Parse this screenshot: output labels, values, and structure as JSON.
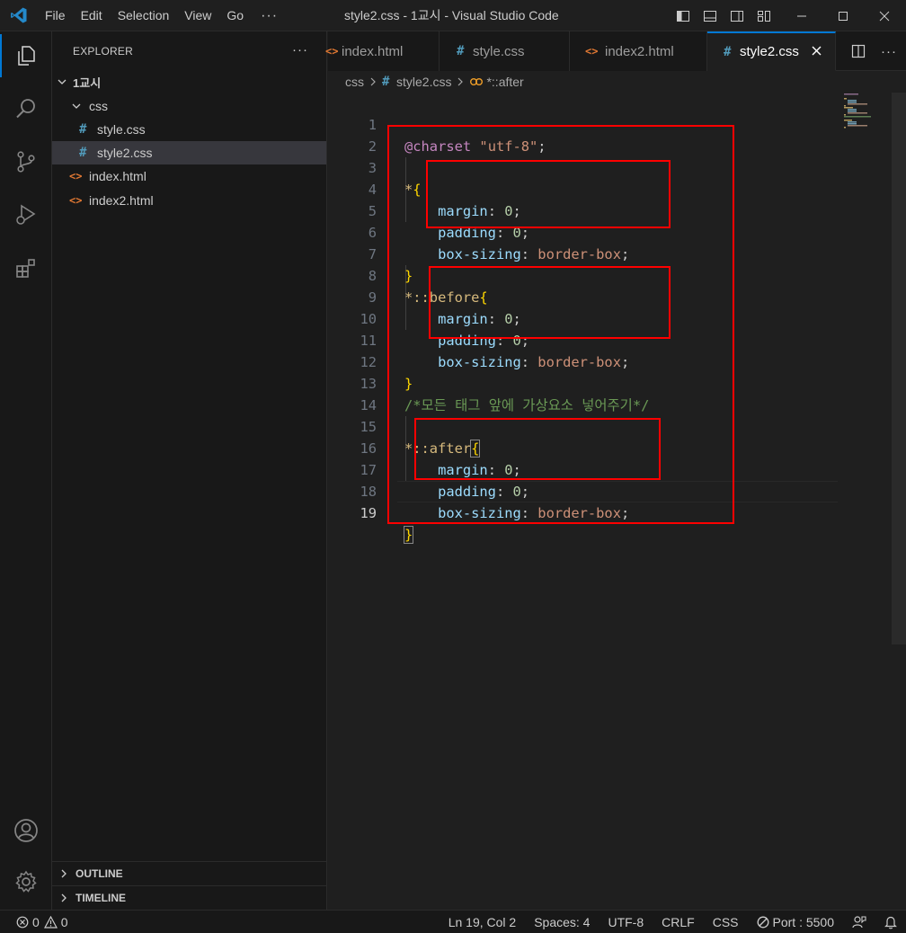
{
  "window": {
    "title": "style2.css - 1교시 - Visual Studio Code",
    "menu": [
      "File",
      "Edit",
      "Selection",
      "View",
      "Go"
    ],
    "menu_more": "···"
  },
  "sidebar": {
    "header": "EXPLORER",
    "header_more": "···",
    "root_folder": "1교시",
    "folder_css": "css",
    "files": [
      "style.css",
      "style2.css",
      "index.html",
      "index2.html"
    ],
    "outline": "OUTLINE",
    "timeline": "TIMELINE"
  },
  "tabs": [
    {
      "label": "index.html",
      "icon": "html-icon"
    },
    {
      "label": "style.css",
      "icon": "css-hash-icon"
    },
    {
      "label": "index2.html",
      "icon": "html-icon"
    },
    {
      "label": "style2.css",
      "icon": "css-hash-icon",
      "active": true
    }
  ],
  "breadcrumb": {
    "folder": "css",
    "file": "style2.css",
    "symbol": "*::after"
  },
  "editor": {
    "line_numbers": [
      "1",
      "2",
      "3",
      "4",
      "5",
      "6",
      "7",
      "8",
      "9",
      "10",
      "11",
      "12",
      "13",
      "14",
      "15",
      "16",
      "17",
      "18",
      "19"
    ],
    "code": {
      "l1_at": "@charset",
      "l1_str": "\"utf-8\"",
      "l1_end": ";",
      "sel_universal": "*",
      "sel_before": "*::before",
      "sel_after": "*::after",
      "open_brace": "{",
      "close_brace": "}",
      "prop_margin": "margin",
      "prop_padding": "padding",
      "prop_boxsizing": "box-sizing",
      "colon": ": ",
      "zero": "0",
      "semi": ";",
      "val_borderbox": "border-box",
      "comment": "/*모든 태그 앞에 가상요소 넣어주기*/"
    }
  },
  "statusbar": {
    "errors": "0",
    "warnings": "0",
    "position": "Ln 19, Col 2",
    "spaces": "Spaces: 4",
    "encoding": "UTF-8",
    "eol": "CRLF",
    "language": "CSS",
    "port": "Port : 5500"
  },
  "colors": {
    "accent": "#0078d4",
    "annotation_box": "#ff0000"
  }
}
